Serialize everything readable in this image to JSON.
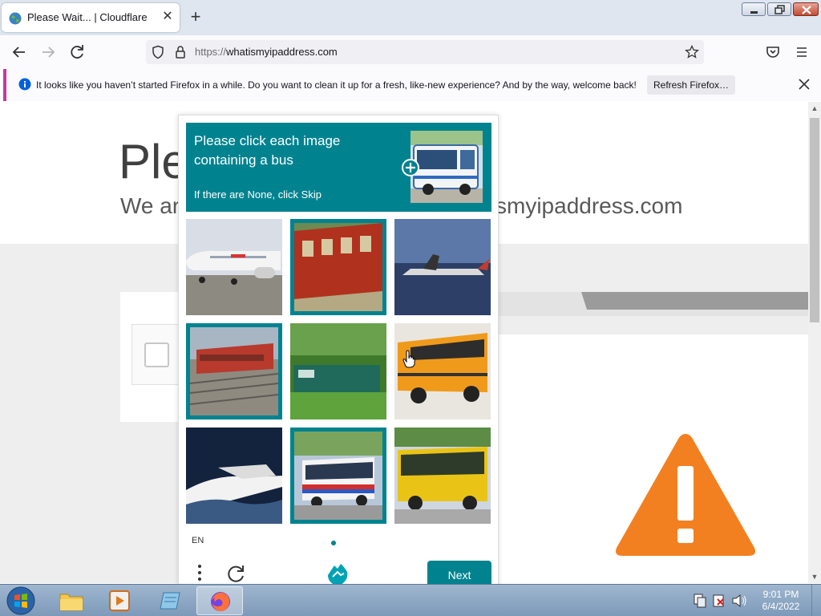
{
  "browser": {
    "tab_title": "Please Wait... | Cloudflare",
    "url_protocol": "https://",
    "url_host": "whatismyipaddress.com",
    "notification": "It looks like you haven’t started Firefox in a while. Do you want to clean it up for a fresh, like-new experience? And by the way, welcome back!",
    "refresh_button": "Refresh Firefox…"
  },
  "page": {
    "heading_partial": "Ple",
    "sub_left_partial": "We ar",
    "sub_right_partial": "smyipaddress.com"
  },
  "captcha": {
    "prompt": "Please click each image containing a bus",
    "hint": "If there are None, click Skip",
    "tiles": [
      {
        "name": "airplane",
        "selected": false
      },
      {
        "name": "train-car",
        "selected": true
      },
      {
        "name": "aircraft-sea",
        "selected": false
      },
      {
        "name": "passenger-train",
        "selected": true
      },
      {
        "name": "green-locomotive",
        "selected": false
      },
      {
        "name": "school-bus",
        "selected": false
      },
      {
        "name": "speedboat",
        "selected": false
      },
      {
        "name": "city-bus",
        "selected": true
      },
      {
        "name": "yellow-coach",
        "selected": false
      }
    ],
    "language": "EN",
    "next_button": "Next"
  },
  "taskbar": {
    "time": "9:01 PM",
    "date": "6/4/2022"
  },
  "colors": {
    "accent": "#00838f",
    "warning": "#f38020",
    "notification_stripe": "#c63aa0"
  }
}
